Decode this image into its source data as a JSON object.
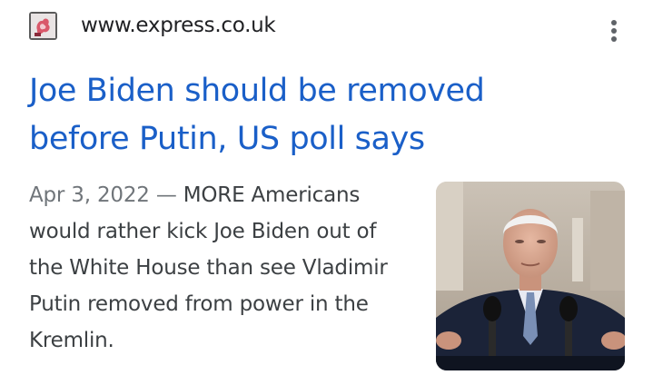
{
  "source": {
    "favicon_icon": "express-favicon-icon",
    "url": "www.express.co.uk",
    "menu_icon": "more-vert-icon"
  },
  "result": {
    "title": "Joe Biden should be removed before Putin, US poll says",
    "date": "Apr 3, 2022",
    "separator": " — ",
    "snippet": "MORE Americans would rather kick Joe Biden out of the White House than see Vladimir Putin removed from power in the Kremlin.",
    "thumbnail_icon": "news-photo-thumbnail"
  },
  "colors": {
    "title_link": "#1a5fc8",
    "snippet_text": "#3c4043",
    "date_text": "#70757a",
    "url_text": "#202124"
  }
}
